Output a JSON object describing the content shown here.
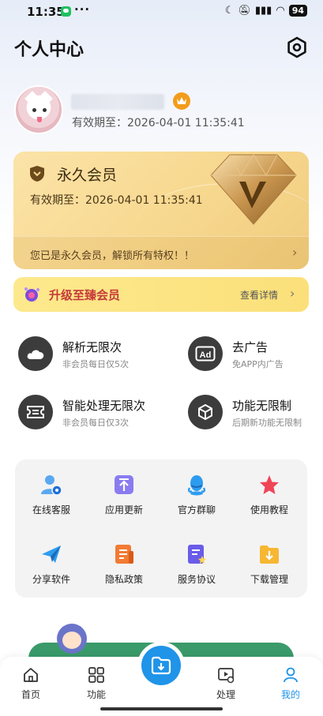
{
  "status_bar": {
    "time": "11:35",
    "dots": "···",
    "battery": "94"
  },
  "header": {
    "title": "个人中心"
  },
  "profile": {
    "validity": "有效期至：2026-04-01 11:35:41"
  },
  "member_card": {
    "title": "永久会员",
    "expiry": "有效期至：2026-04-01 11:35:41",
    "note": "您已是永久会员，解锁所有特权！！"
  },
  "upgrade": {
    "label": "升级至臻会员",
    "detail": "查看详情"
  },
  "privileges": [
    {
      "title": "解析无限次",
      "sub": "非会员每日仅5次",
      "icon": "cloud-icon"
    },
    {
      "title": "去广告",
      "sub": "免APP内广告",
      "icon": "ad-icon"
    },
    {
      "title": "智能处理无限次",
      "sub": "非会员每日仅3次",
      "icon": "ticket-icon"
    },
    {
      "title": "功能无限制",
      "sub": "后期新功能无限制",
      "icon": "cube-icon"
    }
  ],
  "tools": [
    {
      "label": "在线客服",
      "icon": "support-icon"
    },
    {
      "label": "应用更新",
      "icon": "update-icon"
    },
    {
      "label": "官方群聊",
      "icon": "qq-icon"
    },
    {
      "label": "使用教程",
      "icon": "star-icon"
    },
    {
      "label": "分享软件",
      "icon": "paper-plane-icon"
    },
    {
      "label": "隐私政策",
      "icon": "document-icon"
    },
    {
      "label": "服务协议",
      "icon": "agreement-icon"
    },
    {
      "label": "下载管理",
      "icon": "download-folder-icon"
    }
  ],
  "nav": [
    {
      "label": "首页",
      "icon": "home-icon"
    },
    {
      "label": "功能",
      "icon": "grid-icon"
    },
    {
      "label": "处理",
      "icon": "video-process-icon"
    },
    {
      "label": "我的",
      "icon": "person-icon"
    }
  ],
  "colors": {
    "accent": "#1f94e8",
    "gold": "#f7d88f",
    "upgrade_text": "#c53a3a"
  }
}
